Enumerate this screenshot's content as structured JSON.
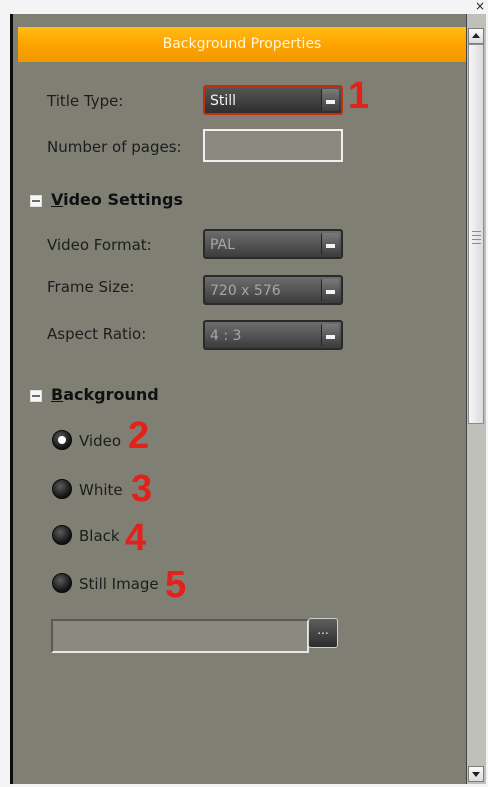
{
  "window": {
    "close_glyph": "×"
  },
  "header": {
    "title": "Background Properties"
  },
  "fields": {
    "title_type": {
      "label": "Title Type:",
      "value": "Still"
    },
    "number_of_pages": {
      "label": "Number of pages:",
      "value": ""
    }
  },
  "video_settings": {
    "toggle": "minus",
    "title_underlined": "V",
    "title_rest": "ideo Settings",
    "video_format": {
      "label": "Video Format:",
      "value": "PAL"
    },
    "frame_size": {
      "label": "Frame Size:",
      "value": "720 x 576"
    },
    "aspect_ratio": {
      "label": "Aspect Ratio:",
      "value": "4 : 3"
    }
  },
  "background": {
    "toggle": "minus",
    "title_underlined": "B",
    "title_rest": "ackground",
    "options": [
      {
        "label": "Video",
        "checked": true
      },
      {
        "label": "White",
        "checked": false
      },
      {
        "label": "Black",
        "checked": false
      },
      {
        "label": "Still Image",
        "checked": false
      }
    ],
    "image_path": {
      "value": ""
    },
    "browse_label": "..."
  },
  "annotations": [
    "1",
    "2",
    "3",
    "4",
    "5"
  ],
  "colors": {
    "header": "#ffa500",
    "panel": "#7f7f74",
    "annotation": "#e2221a"
  }
}
